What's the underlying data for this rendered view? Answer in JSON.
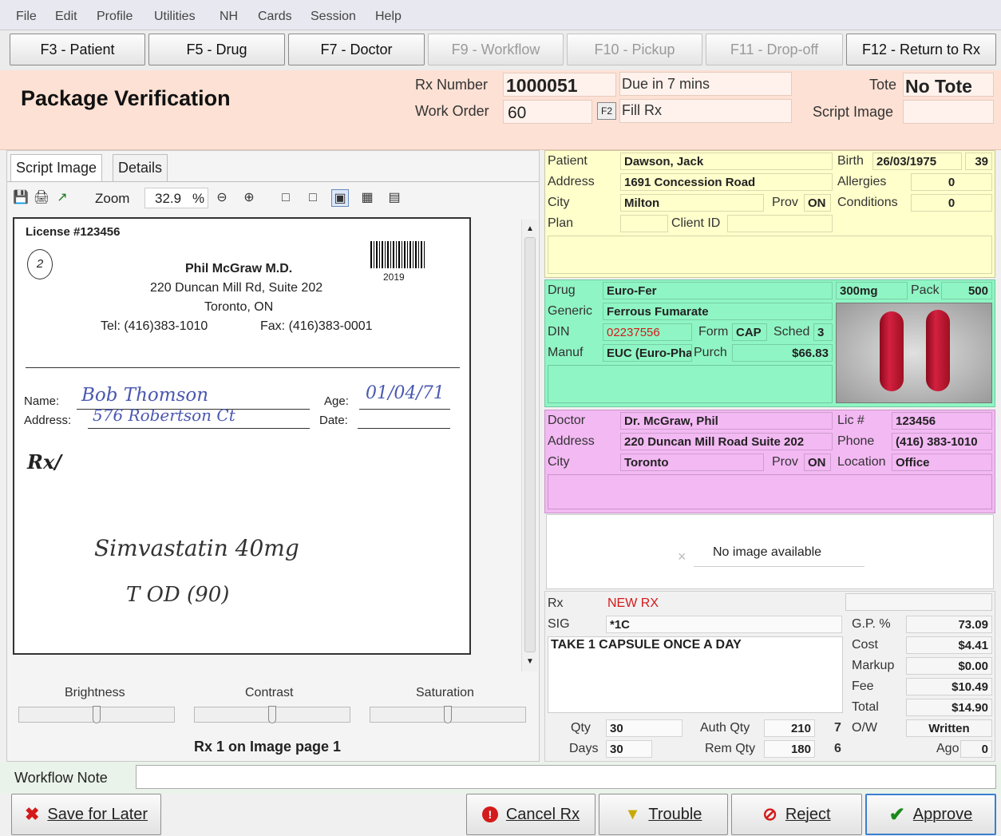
{
  "menu": [
    "File",
    "Edit",
    "Profile",
    "Utilities",
    "NH",
    "Cards",
    "Session",
    "Help"
  ],
  "fkeys": {
    "patient": "F3 - Patient",
    "drug": "F5 - Drug",
    "doctor": "F7 - Doctor",
    "workflow": "F9 - Workflow",
    "pickup": "F10 - Pickup",
    "dropoff": "F11 - Drop-off",
    "return": "F12 - Return to Rx"
  },
  "header": {
    "title": "Package Verification",
    "rx_number_label": "Rx Number",
    "rx_number": "1000051",
    "due": "Due in 7 mins",
    "work_order_label": "Work Order",
    "work_order": "60",
    "f2": "F2",
    "fill_rx": "Fill Rx",
    "tote_label": "Tote",
    "tote": "No Tote",
    "script_image_label": "Script Image"
  },
  "left": {
    "tab_script": "Script Image",
    "tab_details": "Details",
    "zoom_label": "Zoom",
    "zoom_value": "32.9",
    "zoom_unit": "%",
    "script": {
      "license": "License #123456",
      "doctor": "Phil McGraw M.D.",
      "address": "220 Duncan Mill Rd, Suite 202",
      "city": "Toronto, ON",
      "tel": "Tel: (416)383-1010",
      "fax": "Fax: (416)383-0001",
      "barcode_num": "2019",
      "circle": "2",
      "name_label": "Name:",
      "name_value": "Bob Thomson",
      "age_label": "Age:",
      "age_value": "01/04/71",
      "address_label": "Address:",
      "address_value": "576 Robertson Ct",
      "date_label": "Date:",
      "rx": "Rx/",
      "hand1": "Simvastatin 40mg",
      "hand2": "T OD (90)"
    },
    "brightness": "Brightness",
    "contrast": "Contrast",
    "saturation": "Saturation",
    "page_info": "Rx 1 on Image page 1"
  },
  "patient": {
    "patient_label": "Patient",
    "patient": "Dawson, Jack",
    "birth_label": "Birth",
    "birth": "26/03/1975",
    "age": "39",
    "address_label": "Address",
    "address": "1691 Concession Road",
    "allergies_label": "Allergies",
    "allergies": "0",
    "city_label": "City",
    "city": "Milton",
    "prov_label": "Prov",
    "prov": "ON",
    "conditions_label": "Conditions",
    "conditions": "0",
    "plan_label": "Plan",
    "client_id_label": "Client ID"
  },
  "drug": {
    "drug_label": "Drug",
    "drug": "Euro-Fer",
    "strength": "300mg",
    "pack_label": "Pack",
    "pack": "500",
    "generic_label": "Generic",
    "generic": "Ferrous Fumarate",
    "din_label": "DIN",
    "din": "02237556",
    "form_label": "Form",
    "form": "CAP",
    "sched_label": "Sched",
    "sched": "3",
    "manuf_label": "Manuf",
    "manuf": "EUC (Euro-Pha",
    "purch_label": "Purch",
    "purch": "$66.83"
  },
  "doctor": {
    "doctor_label": "Doctor",
    "doctor": "Dr. McGraw, Phil",
    "lic_label": "Lic #",
    "lic": "123456",
    "address_label": "Address",
    "address": "220 Duncan Mill Road Suite 202",
    "phone_label": "Phone",
    "phone": "(416) 383-1010",
    "city_label": "City",
    "city": "Toronto",
    "prov_label": "Prov",
    "prov": "ON",
    "location_label": "Location",
    "location": "Office"
  },
  "noimage": "No image available",
  "rx": {
    "rx_label": "Rx",
    "status": "NEW RX",
    "sig_label": "SIG",
    "sig": "*1C",
    "directions": "TAKE 1 CAPSULE ONCE A DAY",
    "gp_label": "G.P. %",
    "gp": "73.09",
    "cost_label": "Cost",
    "cost": "$4.41",
    "markup_label": "Markup",
    "markup": "$0.00",
    "fee_label": "Fee",
    "fee": "$10.49",
    "total_label": "Total",
    "total": "$14.90",
    "qty_label": "Qty",
    "qty": "30",
    "auth_label": "Auth Qty",
    "auth": "210",
    "auth_fills": "7",
    "ow_label": "O/W",
    "ow": "Written",
    "days_label": "Days",
    "days": "30",
    "rem_label": "Rem Qty",
    "rem": "180",
    "rem_fills": "6",
    "ago_label": "Ago",
    "ago": "0"
  },
  "workflow_note_label": "Workflow Note",
  "buttons": {
    "save": "Save for Later",
    "cancel": "Cancel Rx",
    "trouble": "Trouble",
    "reject": "Reject",
    "approve": "Approve"
  },
  "colors": {
    "header": "#fde1d4",
    "patient": "#ffffcc",
    "drug": "#8ff5c4",
    "doctor": "#f3b9f3",
    "alert": "#d41a1a"
  }
}
